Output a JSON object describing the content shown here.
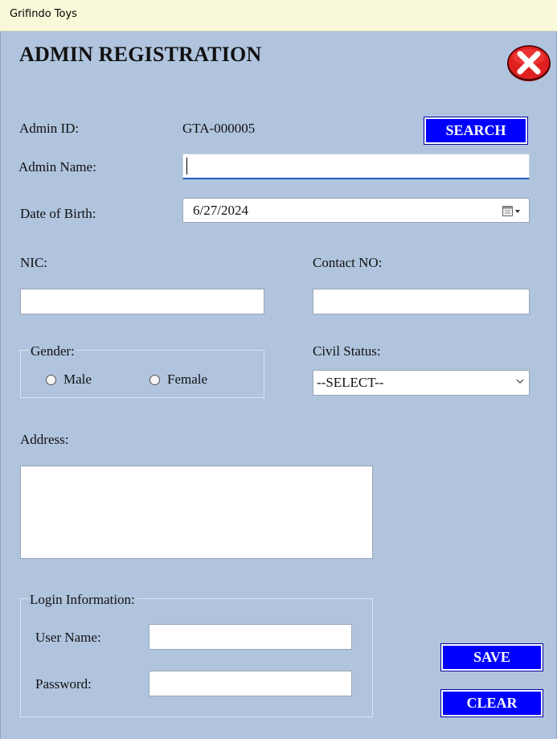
{
  "window": {
    "title": "Grifindo Toys"
  },
  "form": {
    "heading": "ADMIN REGISTRATION",
    "admin_id_label": "Admin ID:",
    "admin_id_value": "GTA-000005",
    "search_label": "SEARCH",
    "admin_name_label": "Admin Name:",
    "admin_name_value": "",
    "dob_label": "Date of Birth:",
    "dob_value": "6/27/2024",
    "nic_label": "NIC:",
    "nic_value": "",
    "contact_label": "Contact NO:",
    "contact_value": "",
    "gender_legend": "Gender:",
    "gender_options": [
      "Male",
      "Female"
    ],
    "civil_status_label": "Civil Status:",
    "civil_status_selected": "--SELECT--",
    "address_label": "Address:",
    "address_value": "",
    "login_legend": "Login Information:",
    "username_label": "User Name:",
    "username_value": "",
    "password_label": "Password:",
    "password_value": "",
    "save_label": "SAVE",
    "clear_label": "CLEAR"
  },
  "icons": {
    "close": "close-icon",
    "calendar": "calendar-icon",
    "dropdown": "chevron-down-icon"
  },
  "colors": {
    "title_bar": "#f9f9d9",
    "form_background": "#b0c4de",
    "button": "#0000ff",
    "close_button": "#e02020"
  }
}
